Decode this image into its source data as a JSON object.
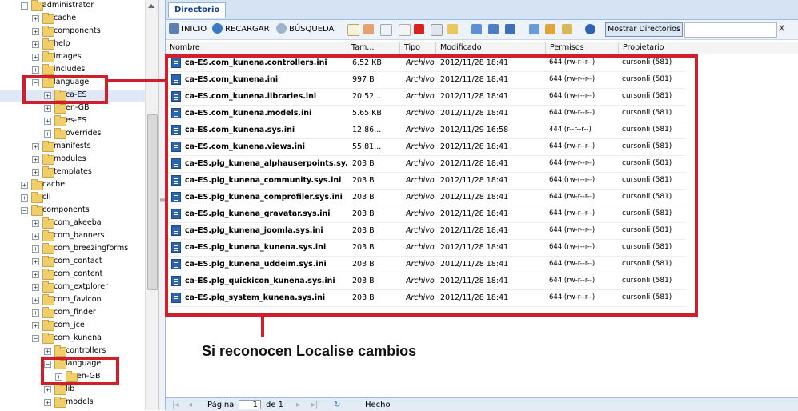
{
  "tree": {
    "items": [
      {
        "label": "administrator",
        "toggle": "−"
      },
      {
        "label": "cache",
        "toggle": "+"
      },
      {
        "label": "components",
        "toggle": "+"
      },
      {
        "label": "help",
        "toggle": "+"
      },
      {
        "label": "images",
        "toggle": "+"
      },
      {
        "label": "includes",
        "toggle": "+"
      },
      {
        "label": "language",
        "toggle": "−"
      },
      {
        "label": "ca-ES",
        "toggle": "+"
      },
      {
        "label": "en-GB",
        "toggle": "+"
      },
      {
        "label": "es-ES",
        "toggle": "+"
      },
      {
        "label": "overrides",
        "toggle": "+"
      },
      {
        "label": "manifests",
        "toggle": "+"
      },
      {
        "label": "modules",
        "toggle": "+"
      },
      {
        "label": "templates",
        "toggle": "+"
      },
      {
        "label": "cache",
        "toggle": "+"
      },
      {
        "label": "cli",
        "toggle": "+"
      },
      {
        "label": "components",
        "toggle": "−"
      },
      {
        "label": "com_akeeba",
        "toggle": "+"
      },
      {
        "label": "com_banners",
        "toggle": "+"
      },
      {
        "label": "com_breezingforms",
        "toggle": "+"
      },
      {
        "label": "com_contact",
        "toggle": "+"
      },
      {
        "label": "com_content",
        "toggle": "+"
      },
      {
        "label": "com_extplorer",
        "toggle": "+"
      },
      {
        "label": "com_favicon",
        "toggle": "+"
      },
      {
        "label": "com_finder",
        "toggle": "+"
      },
      {
        "label": "com_jce",
        "toggle": "+"
      },
      {
        "label": "com_kunena",
        "toggle": "−"
      },
      {
        "label": "controllers",
        "toggle": "+"
      },
      {
        "label": "language",
        "toggle": "−"
      },
      {
        "label": "en-GB",
        "toggle": "+"
      },
      {
        "label": "lib",
        "toggle": "+"
      },
      {
        "label": "models",
        "toggle": "+"
      }
    ]
  },
  "panel": {
    "tab_label": "Directorio"
  },
  "toolbar": {
    "home_label": "INICIO",
    "reload_label": "RECARGAR",
    "search_label": "BÚSQUEDA",
    "show_dirs_label": "Mostrar Directorios",
    "search_value": "",
    "clear_label": "X"
  },
  "grid": {
    "columns": [
      "Nombre",
      "Tam...",
      "Tipo",
      "Modificado",
      "Permisos",
      "Propietario"
    ],
    "rows": [
      {
        "name": "ca-ES.com_kunena.controllers.ini",
        "size": "6.52 KB",
        "type": "Archivo",
        "modified": "2012/11/28 18:41",
        "perms": "644 (rw-r--r--)",
        "owner": "cursonli (581)"
      },
      {
        "name": "ca-ES.com_kunena.ini",
        "size": "997 B",
        "type": "Archivo",
        "modified": "2012/11/28 18:41",
        "perms": "644 (rw-r--r--)",
        "owner": "cursonli (581)"
      },
      {
        "name": "ca-ES.com_kunena.libraries.ini",
        "size": "20.52...",
        "type": "Archivo",
        "modified": "2012/11/28 18:41",
        "perms": "644 (rw-r--r--)",
        "owner": "cursonli (581)"
      },
      {
        "name": "ca-ES.com_kunena.models.ini",
        "size": "5.65 KB",
        "type": "Archivo",
        "modified": "2012/11/28 18:41",
        "perms": "644 (rw-r--r--)",
        "owner": "cursonli (581)"
      },
      {
        "name": "ca-ES.com_kunena.sys.ini",
        "size": "12.86...",
        "type": "Archivo",
        "modified": "2012/11/29 16:58",
        "perms": "444 (r--r--r--)",
        "owner": "cursonli (581)"
      },
      {
        "name": "ca-ES.com_kunena.views.ini",
        "size": "55.81...",
        "type": "Archivo",
        "modified": "2012/11/28 18:41",
        "perms": "644 (rw-r--r--)",
        "owner": "cursonli (581)"
      },
      {
        "name": "ca-ES.plg_kunena_alphauserpoints.sy...",
        "size": "203 B",
        "type": "Archivo",
        "modified": "2012/11/28 18:41",
        "perms": "644 (rw-r--r--)",
        "owner": "cursonli (581)"
      },
      {
        "name": "ca-ES.plg_kunena_community.sys.ini",
        "size": "203 B",
        "type": "Archivo",
        "modified": "2012/11/28 18:41",
        "perms": "644 (rw-r--r--)",
        "owner": "cursonli (581)"
      },
      {
        "name": "ca-ES.plg_kunena_comprofiler.sys.ini",
        "size": "203 B",
        "type": "Archivo",
        "modified": "2012/11/28 18:41",
        "perms": "644 (rw-r--r--)",
        "owner": "cursonli (581)"
      },
      {
        "name": "ca-ES.plg_kunena_gravatar.sys.ini",
        "size": "203 B",
        "type": "Archivo",
        "modified": "2012/11/28 18:41",
        "perms": "644 (rw-r--r--)",
        "owner": "cursonli (581)"
      },
      {
        "name": "ca-ES.plg_kunena_joomla.sys.ini",
        "size": "203 B",
        "type": "Archivo",
        "modified": "2012/11/28 18:41",
        "perms": "644 (rw-r--r--)",
        "owner": "cursonli (581)"
      },
      {
        "name": "ca-ES.plg_kunena_kunena.sys.ini",
        "size": "203 B",
        "type": "Archivo",
        "modified": "2012/11/28 18:41",
        "perms": "644 (rw-r--r--)",
        "owner": "cursonli (581)"
      },
      {
        "name": "ca-ES.plg_kunena_uddeim.sys.ini",
        "size": "203 B",
        "type": "Archivo",
        "modified": "2012/11/28 18:41",
        "perms": "644 (rw-r--r--)",
        "owner": "cursonli (581)"
      },
      {
        "name": "ca-ES.plg_quickicon_kunena.sys.ini",
        "size": "203 B",
        "type": "Archivo",
        "modified": "2012/11/28 18:41",
        "perms": "644 (rw-r--r--)",
        "owner": "cursonli (581)"
      },
      {
        "name": "ca-ES.plg_system_kunena.sys.ini",
        "size": "203 B",
        "type": "Archivo",
        "modified": "2012/11/28 18:41",
        "perms": "644 (rw-r--r--)",
        "owner": "cursonli (581)"
      }
    ]
  },
  "paging": {
    "page_label": "Página",
    "page_value": "1",
    "of_label": "de 1",
    "status": "Hecho"
  },
  "annotation": {
    "text": "Si reconocen Localise cambios"
  },
  "colors": {
    "annotation_red": "#d01f2a",
    "header_blue": "#d6e3f2",
    "folder_yellow": "#f0cf6b"
  }
}
